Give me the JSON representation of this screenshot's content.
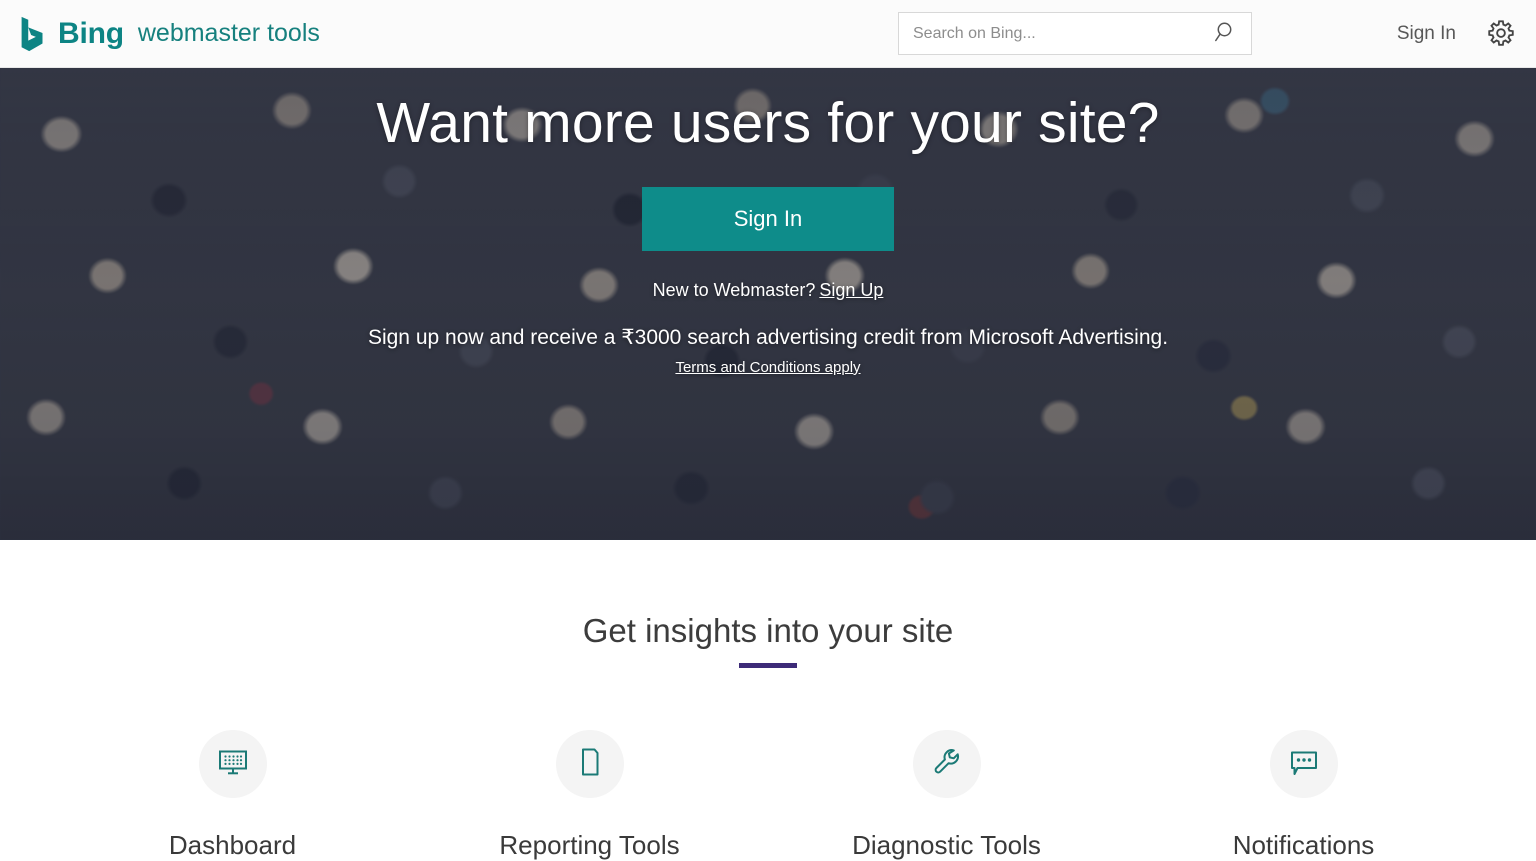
{
  "header": {
    "brand": {
      "logo_icon": "bing-swoosh-icon",
      "name": "Bing",
      "product": "webmaster tools"
    },
    "search": {
      "placeholder": "Search on Bing...",
      "value": "",
      "icon": "search-icon"
    },
    "sign_in_label": "Sign In",
    "settings_icon": "gear-icon"
  },
  "hero": {
    "title": "Want more users for your site?",
    "sign_in_button": "Sign In",
    "new_user_prompt": "New to Webmaster?",
    "sign_up_link": "Sign Up",
    "promo": "Sign up now and receive a ₹3000 search advertising credit from Microsoft Advertising.",
    "terms_link": "Terms and Conditions apply",
    "background_image": "crowd-of-people-photo"
  },
  "insights": {
    "title": "Get insights into your site",
    "accent_color": "#3d2b78",
    "features": [
      {
        "label": "Dashboard",
        "icon": "monitor-icon"
      },
      {
        "label": "Reporting Tools",
        "icon": "document-icon"
      },
      {
        "label": "Diagnostic Tools",
        "icon": "wrench-icon"
      },
      {
        "label": "Notifications",
        "icon": "speech-bubble-icon"
      }
    ]
  },
  "theme": {
    "teal": "#0e8c8a",
    "brand_teal": "#0d8484",
    "purple": "#3d2b78",
    "text_dark": "#3a3a3a"
  }
}
